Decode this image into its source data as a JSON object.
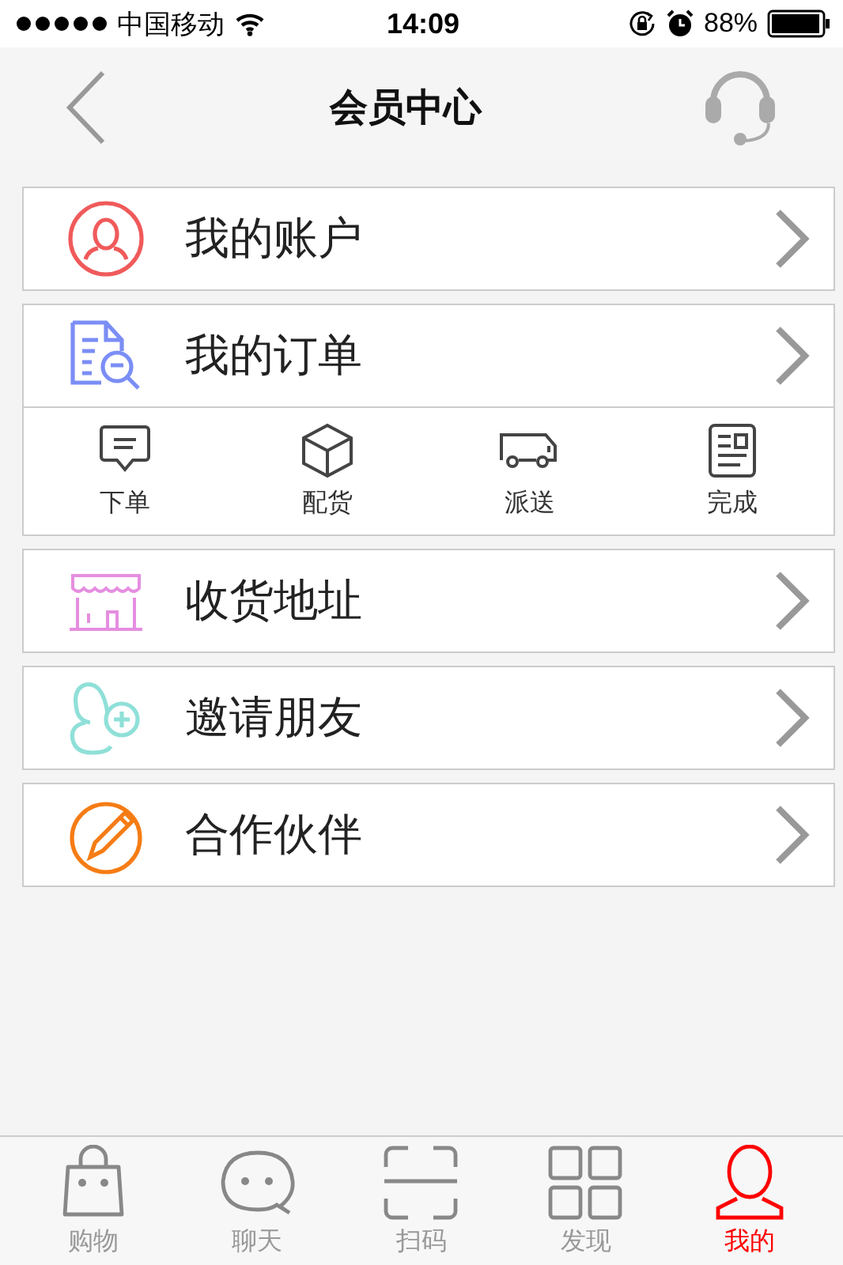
{
  "status_bar": {
    "carrier": "中国移动",
    "time": "14:09",
    "battery": "88%"
  },
  "nav": {
    "title": "会员中心"
  },
  "cards": [
    {
      "items": [
        {
          "kind": "account",
          "label": "我的账户",
          "color": "#f05a5a"
        }
      ]
    },
    {
      "items": [
        {
          "kind": "order",
          "label": "我的订单",
          "color": "#7b8ef5"
        }
      ],
      "steps": [
        {
          "kind": "place",
          "label": "下单"
        },
        {
          "kind": "pack",
          "label": "配货"
        },
        {
          "kind": "deliver",
          "label": "派送"
        },
        {
          "kind": "done",
          "label": "完成"
        }
      ]
    },
    {
      "items": [
        {
          "kind": "address",
          "label": "收货地址",
          "color": "#e58ee0"
        }
      ]
    },
    {
      "items": [
        {
          "kind": "invite",
          "label": "邀请朋友",
          "color": "#8fe0d8"
        }
      ]
    },
    {
      "items": [
        {
          "kind": "partner",
          "label": "合作伙伴",
          "color": "#f57c14"
        }
      ]
    }
  ],
  "tabs": [
    {
      "kind": "shop",
      "label": "购物",
      "selected": false
    },
    {
      "kind": "chat",
      "label": "聊天",
      "selected": false
    },
    {
      "kind": "scan",
      "label": "扫码",
      "selected": false
    },
    {
      "kind": "discover",
      "label": "发现",
      "selected": false
    },
    {
      "kind": "me",
      "label": "我的",
      "selected": true
    }
  ]
}
